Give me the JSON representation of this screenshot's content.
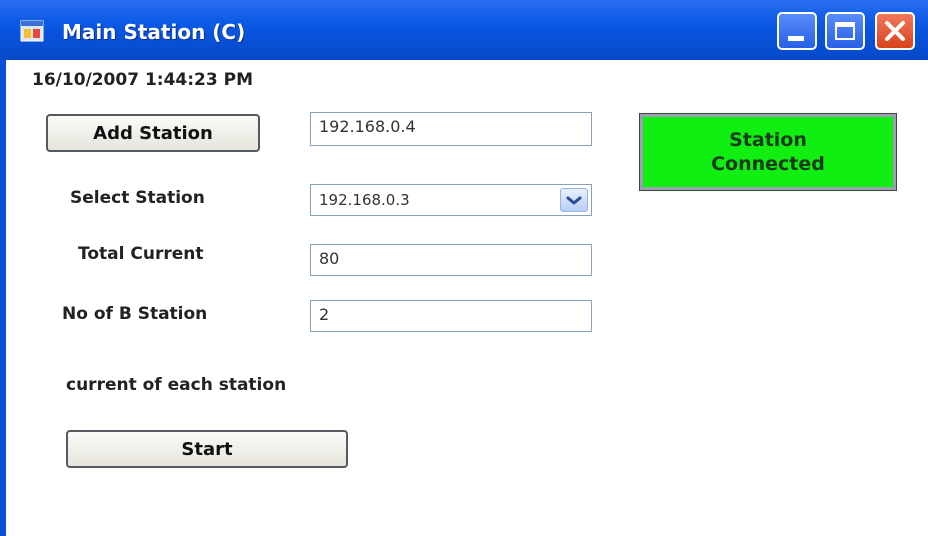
{
  "window": {
    "title": "Main Station (C)",
    "icons": {
      "app": "window-app-icon",
      "minimize": "minimize-icon",
      "maximize": "maximize-icon",
      "close": "close-icon"
    }
  },
  "datetime": "16/10/2007 1:44:23 PM",
  "add_station": {
    "button_label": "Add Station",
    "ip_value": "192.168.0.4"
  },
  "select_station": {
    "label": "Select Station",
    "selected": "192.168.0.3",
    "dropdown_icon": "chevron-down-icon"
  },
  "total_current": {
    "label": "Total Current",
    "value": "80"
  },
  "b_stations": {
    "label": "No of B Station",
    "value": "2"
  },
  "current_each_label": "current of each station",
  "start_button_label": "Start",
  "status": {
    "line1": "Station",
    "line2": "Connected",
    "color": "#11ee11"
  }
}
